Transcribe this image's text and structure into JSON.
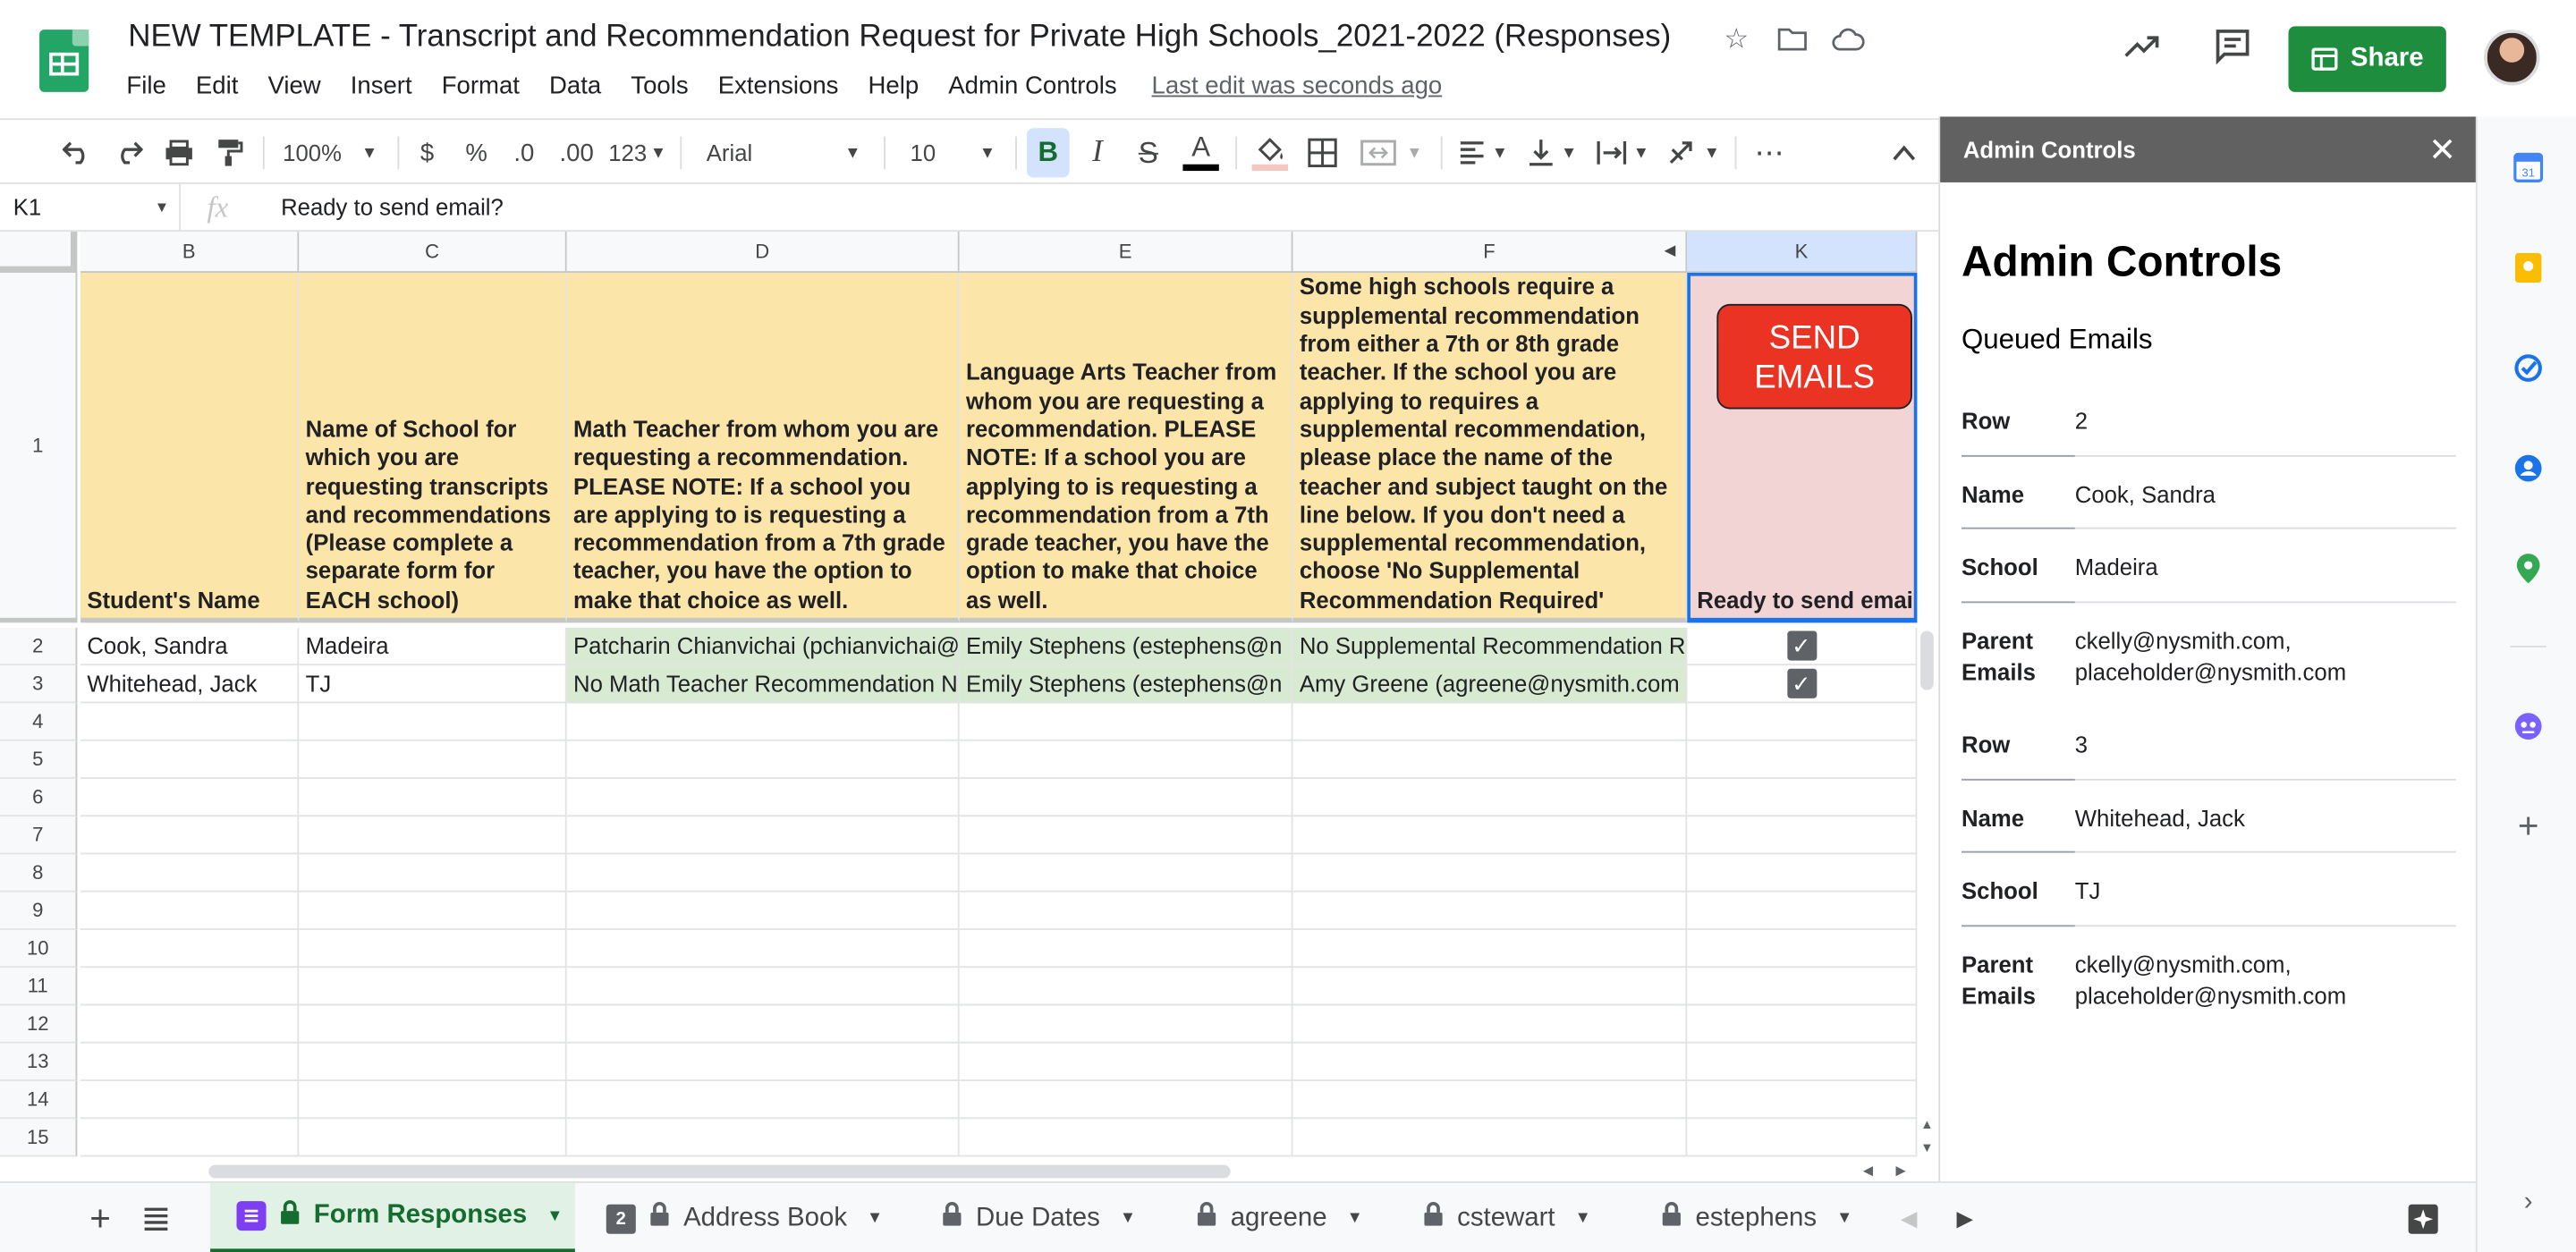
{
  "doc": {
    "title": "NEW TEMPLATE - Transcript and Recommendation Request for Private High Schools_2021-2022 (Responses)",
    "last_edit": "Last edit was seconds ago",
    "menu": [
      "File",
      "Edit",
      "View",
      "Insert",
      "Format",
      "Data",
      "Tools",
      "Extensions",
      "Help",
      "Admin Controls"
    ],
    "share_label": "Share"
  },
  "toolbar": {
    "zoom": "100%",
    "currency": "$",
    "percent": "%",
    "dec_decrease": ".0",
    "dec_increase": ".00",
    "more_formats": "123",
    "font": "Arial",
    "font_size": "10"
  },
  "formula_bar": {
    "cell_ref": "K1",
    "content": "Ready to send email?"
  },
  "grid": {
    "columns": [
      "B",
      "C",
      "D",
      "E",
      "F",
      "K"
    ],
    "row_numbers": [
      "1",
      "2",
      "3",
      "4",
      "5",
      "6",
      "7",
      "8",
      "9",
      "10",
      "11",
      "12",
      "13",
      "14",
      "15"
    ],
    "headers": {
      "B": "Student's Name",
      "C": "Name of School for which you are requesting transcripts and recommendations (Please complete a separate form for EACH school)",
      "D": "Math Teacher from whom you are requesting a recommendation. PLEASE NOTE: If a school you are applying to is requesting a recommendation from a 7th grade teacher, you have the option to make that choice as well.",
      "E": "Language Arts Teacher from whom you are requesting a recommendation. PLEASE NOTE: If a school you are applying to is requesting a recommendation from a 7th grade teacher, you have the option to make that choice as well.",
      "F": "Some high schools require a supplemental recommendation from either a 7th or 8th grade teacher. If the school you are applying to requires a supplemental recommendation, please place the name of the teacher and subject taught on the line below. If you don't need a supplemental recommendation, choose 'No Supplemental Recommendation Required'",
      "K": "Ready to send emai"
    },
    "send_button": "SEND EMAILS",
    "rows": [
      {
        "B": "Cook, Sandra",
        "C": "Madeira",
        "D": "Patcharin Chianvichai (pchianvichai@",
        "E": "Emily Stephens (estephens@n",
        "F": "No Supplemental Recommendation R",
        "K_checked": true
      },
      {
        "B": "Whitehead, Jack",
        "C": "TJ",
        "D": "No Math Teacher Recommendation N",
        "E": "Emily Stephens (estephens@n",
        "F": "Amy Greene (agreene@nysmith.com",
        "K_checked": true
      }
    ]
  },
  "sheet_tabs": [
    {
      "label": "Form Responses",
      "active": true,
      "badge": ""
    },
    {
      "label": "Address Book",
      "active": false,
      "badge": "2"
    },
    {
      "label": "Due Dates",
      "active": false,
      "badge": ""
    },
    {
      "label": "agreene",
      "active": false,
      "badge": ""
    },
    {
      "label": "cstewart",
      "active": false,
      "badge": ""
    },
    {
      "label": "estephens",
      "active": false,
      "badge": ""
    }
  ],
  "panel": {
    "header": "Admin Controls",
    "title": "Admin Controls",
    "subtitle": "Queued Emails",
    "entries": [
      {
        "row_label": "Row",
        "row": "2",
        "name_label": "Name",
        "name": "Cook, Sandra",
        "school_label": "School",
        "school": "Madeira",
        "parent_label_1": "Parent",
        "parent_label_2": "Emails",
        "parent_1": "ckelly@nysmith.com,",
        "parent_2": "placeholder@nysmith.com"
      },
      {
        "row_label": "Row",
        "row": "3",
        "name_label": "Name",
        "name": "Whitehead, Jack",
        "school_label": "School",
        "school": "TJ",
        "parent_label_1": "Parent",
        "parent_label_2": "Emails",
        "parent_1": "ckelly@nysmith.com,",
        "parent_2": "placeholder@nysmith.com"
      }
    ]
  },
  "colors": {
    "header_fill": "#fce5a8",
    "row_fill": "#d9ead3",
    "send_button": "#ea3323",
    "share_button": "#1e8e3e",
    "panel_header": "#616161"
  }
}
